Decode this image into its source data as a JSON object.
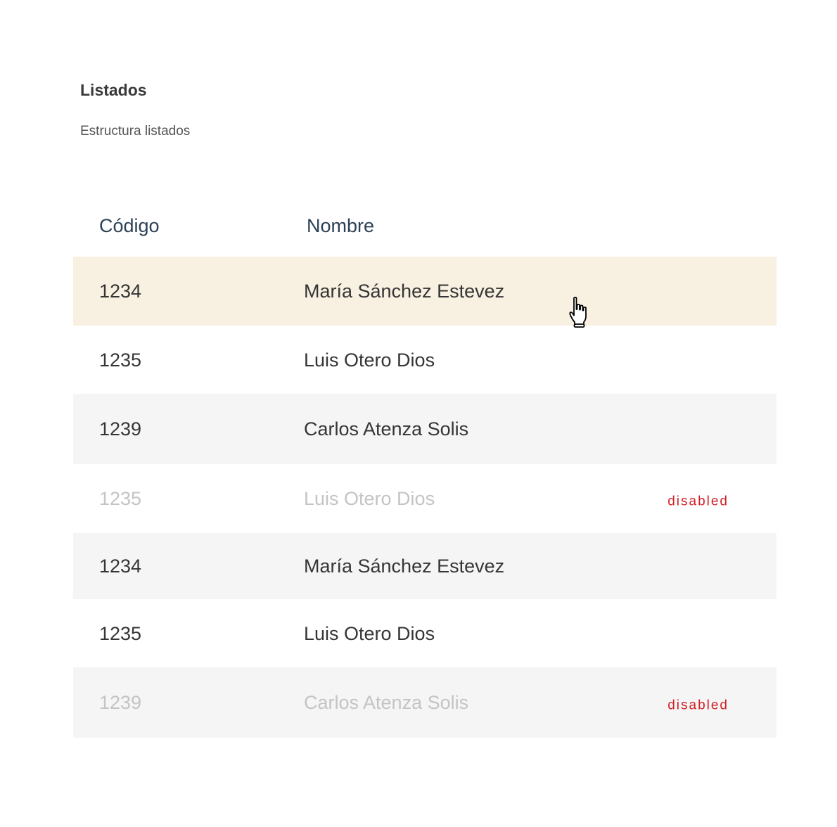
{
  "page": {
    "title": "Listados",
    "subtitle": "Estructura listados"
  },
  "table": {
    "columns": {
      "code": "Código",
      "name": "Nombre"
    },
    "rows": [
      {
        "code": "1234",
        "name": "María Sánchez Estevez",
        "status": "",
        "state": "hover"
      },
      {
        "code": "1235",
        "name": "Luis Otero Dios",
        "status": "",
        "state": "normal"
      },
      {
        "code": "1239",
        "name": "Carlos Atenza Solis",
        "status": "",
        "state": "normal"
      },
      {
        "code": "1235",
        "name": "Luis Otero Dios",
        "status": "disabled",
        "state": "disabled"
      },
      {
        "code": "1234",
        "name": "María Sánchez Estevez",
        "status": "",
        "state": "normal"
      },
      {
        "code": "1235",
        "name": "Luis Otero Dios",
        "status": "",
        "state": "normal"
      },
      {
        "code": "1239",
        "name": "Carlos Atenza Solis",
        "status": "disabled",
        "state": "disabled"
      }
    ]
  },
  "colors": {
    "header_text": "#2c4155",
    "row_hover": "#f8f0e1",
    "row_shaded": "#f5f5f5",
    "disabled_text": "#c4c4c4",
    "status_label": "#d21f26"
  },
  "icons": {
    "cursor": "hand-pointer-icon"
  }
}
